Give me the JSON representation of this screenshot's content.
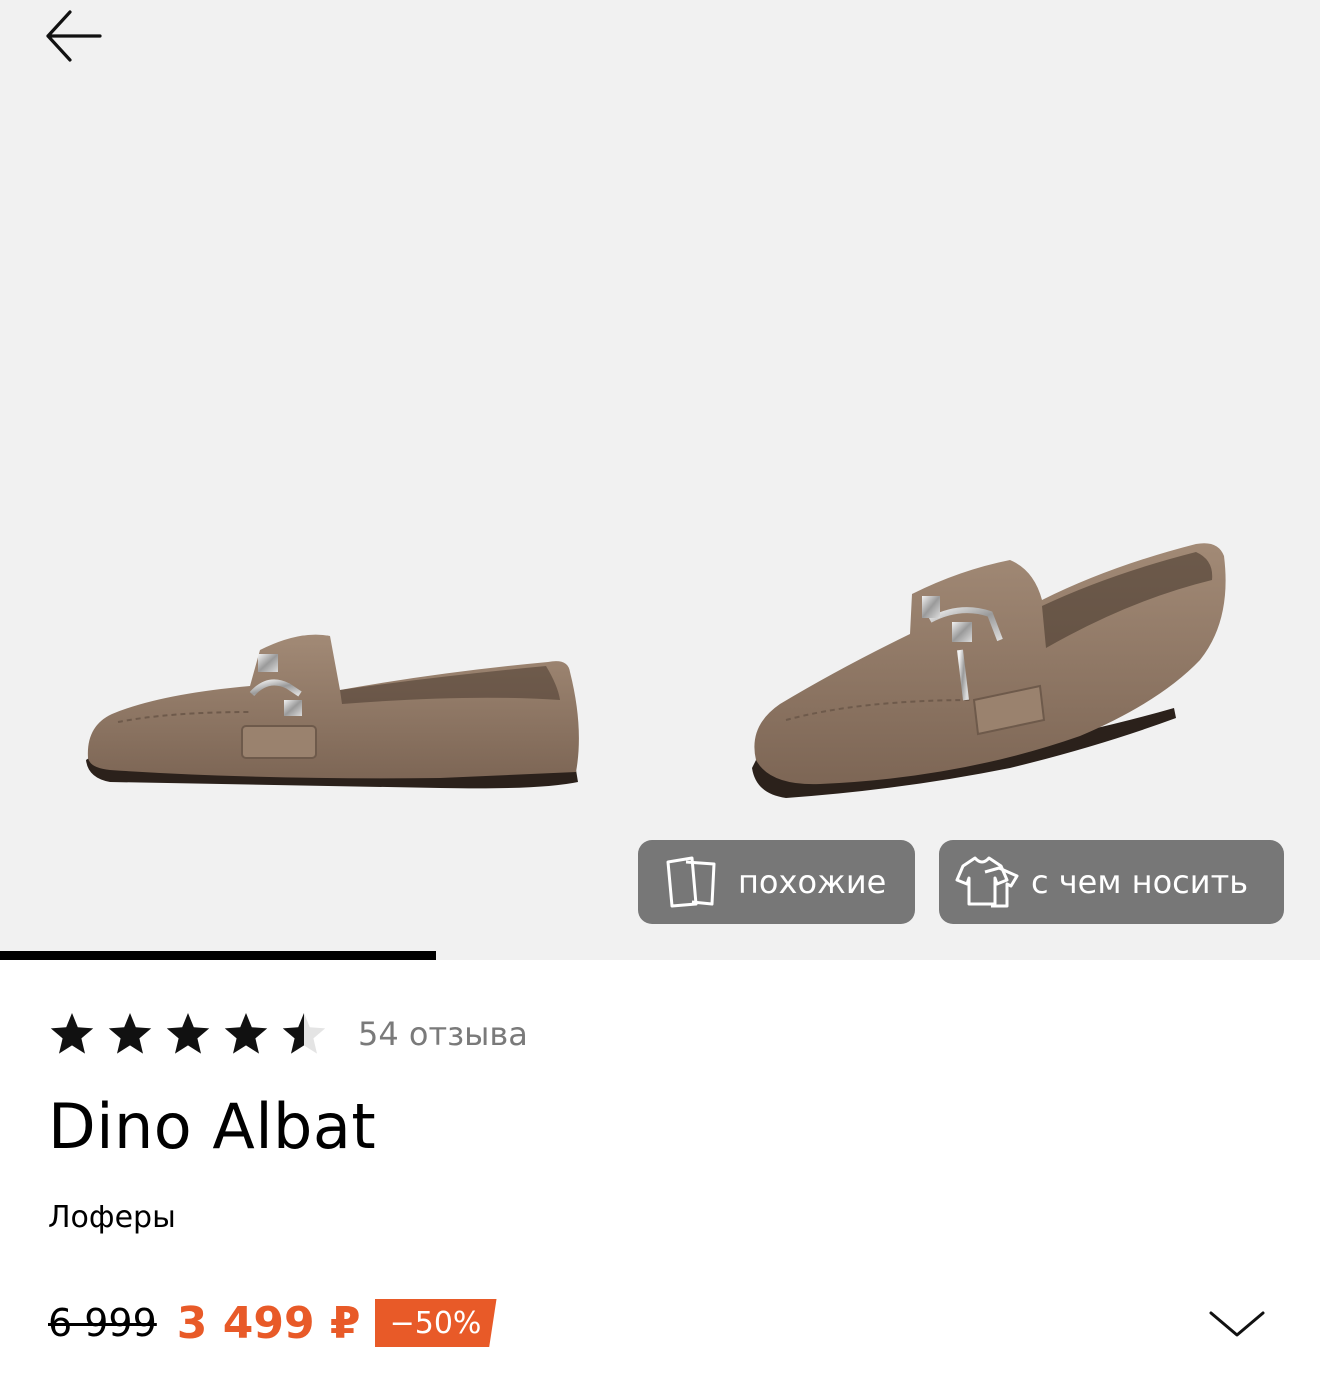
{
  "gallery": {
    "background": "#f1f1f1",
    "progress": 0.33,
    "chips": {
      "similar_label": "похожие",
      "similar_icon": "cards-icon",
      "wear_label": "с чем носить",
      "wear_icon": "clothing-icon"
    }
  },
  "nav": {
    "back_icon": "arrow-left-icon"
  },
  "rating": {
    "value": 4.5,
    "max": 5,
    "reviews": "54 отзыва"
  },
  "product": {
    "brand": "Dino Albat",
    "category": "Лоферы",
    "old_price": "6 999",
    "price": "3 499 ₽",
    "discount": "−50%"
  },
  "colors": {
    "accent": "#e85a28",
    "chip_bg": "#626262",
    "muted_text": "#7a7a7a",
    "shoe_suede": "#8c7563"
  },
  "expand_icon": "chevron-down-icon"
}
